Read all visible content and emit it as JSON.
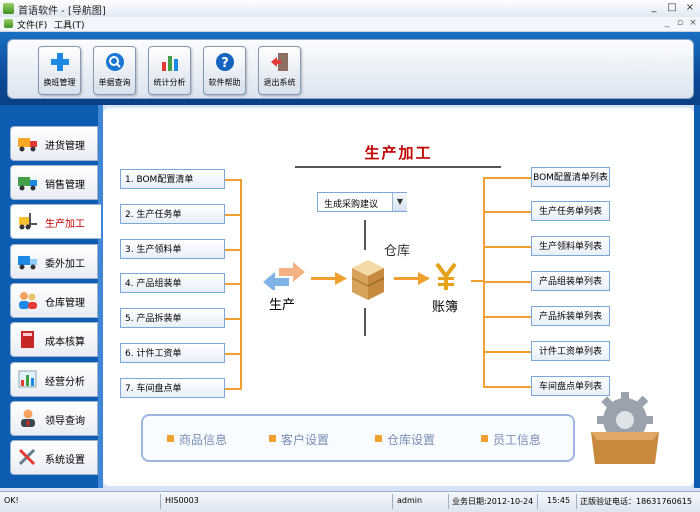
{
  "window": {
    "title": "首语软件 - [导航图]",
    "controls": [
      "_",
      "□",
      "×"
    ]
  },
  "menu": {
    "items": [
      "文件(F)",
      "工具(T)"
    ],
    "mdi_controls": [
      "_",
      "▫",
      "×"
    ]
  },
  "toolbar": {
    "buttons": [
      {
        "label": "换班管理",
        "icon": "plus-icon"
      },
      {
        "label": "单据查询",
        "icon": "magnifier-icon"
      },
      {
        "label": "统计分析",
        "icon": "bar-chart-icon"
      },
      {
        "label": "软件帮助",
        "icon": "help-icon"
      },
      {
        "label": "退出系统",
        "icon": "exit-door-icon"
      }
    ]
  },
  "nav": {
    "items": [
      {
        "label": "进货管理",
        "icon": "truck-icon",
        "active": false
      },
      {
        "label": "销售管理",
        "icon": "delivery-truck-icon",
        "active": false
      },
      {
        "label": "生产加工",
        "icon": "forklift-icon",
        "active": true
      },
      {
        "label": "委外加工",
        "icon": "truck-blue-icon",
        "active": false
      },
      {
        "label": "仓库管理",
        "icon": "people-icon",
        "active": false
      },
      {
        "label": "成本核算",
        "icon": "book-icon",
        "active": false
      },
      {
        "label": "经营分析",
        "icon": "chart-icon",
        "active": false
      },
      {
        "label": "领导查询",
        "icon": "manager-icon",
        "active": false
      },
      {
        "label": "系统设置",
        "icon": "tools-icon",
        "active": false
      }
    ]
  },
  "main": {
    "heading": "生产加工",
    "left_buttons": [
      "1. BOM配置清单",
      "2. 生产任务单",
      "3. 生产领料单",
      "4. 产品组装单",
      "5. 产品拆装单",
      "6. 计件工资单",
      "7. 车间盘点单"
    ],
    "right_buttons": [
      "BOM配置清单列表",
      "生产任务单列表",
      "生产领料单列表",
      "产品组装单列表",
      "产品拆装单列表",
      "计件工资单列表",
      "车间盘点单列表"
    ],
    "combo_value": "生成采购建议",
    "label_production": "生产",
    "label_warehouse": "仓库",
    "label_ledger": "账簿",
    "bottom_links": [
      "商品信息",
      "客户设置",
      "仓库设置",
      "员工信息"
    ]
  },
  "status": {
    "cells": [
      "OK!",
      "HIS0003",
      "admin",
      "业务日期:2012-10-24",
      "15:45",
      "正版验证电话：18631760615"
    ]
  },
  "colors": {
    "accent_blue": "#0f5db3",
    "orange": "#f0a030",
    "heading_red": "#c00000"
  }
}
